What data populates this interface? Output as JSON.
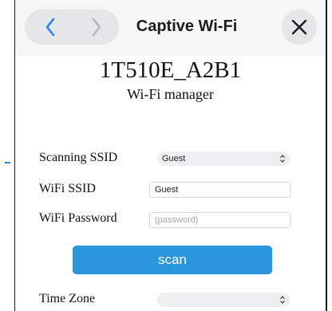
{
  "header": {
    "title": "Captive Wi-Fi",
    "back_icon": "chevron-left-icon",
    "forward_icon": "chevron-right-icon",
    "close_icon": "close-icon",
    "accent_color": "#2a7fff"
  },
  "device": {
    "name": "1T510E_A2B1",
    "subtitle": "Wi-Fi manager"
  },
  "form": {
    "scanning_ssid": {
      "label": "Scanning SSID",
      "selected": "Guest"
    },
    "wifi_ssid": {
      "label": "WiFi SSID",
      "value": "Guest"
    },
    "wifi_password": {
      "label": "WiFi Password",
      "value": "",
      "placeholder": "(password)"
    },
    "scan_button": {
      "label": "scan",
      "color": "#2a96de"
    },
    "time_zone": {
      "label": "Time Zone",
      "selected": ""
    }
  }
}
